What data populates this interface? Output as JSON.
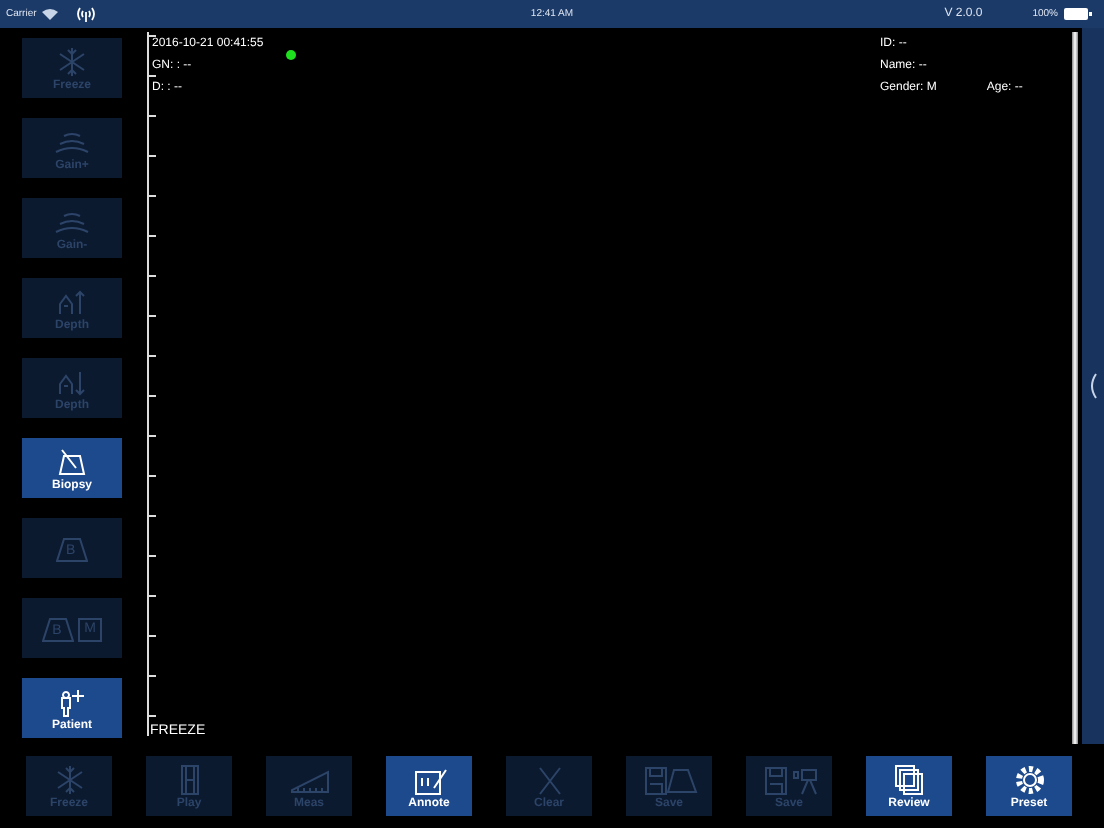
{
  "status_bar": {
    "carrier": "Carrier",
    "time": "12:41 AM",
    "version": "V 2.0.0",
    "battery": "100%"
  },
  "side_buttons": [
    {
      "label": "Freeze",
      "kind": "snowflake",
      "disabled": true
    },
    {
      "label": "Gain+",
      "kind": "gain-up",
      "disabled": true
    },
    {
      "label": "Gain-",
      "kind": "gain-down",
      "disabled": true
    },
    {
      "label": "Depth",
      "kind": "depth-up",
      "disabled": true
    },
    {
      "label": "Depth",
      "kind": "depth-down",
      "disabled": true
    },
    {
      "label": "Biopsy",
      "kind": "biopsy",
      "disabled": false
    },
    {
      "kind": "mode",
      "letters": [
        "B"
      ],
      "disabled": true
    },
    {
      "kind": "mode",
      "letters": [
        "B",
        "M"
      ],
      "disabled": true
    },
    {
      "label": "Patient",
      "kind": "patient",
      "disabled": false
    }
  ],
  "image_area": {
    "datetime": "2016-10-21 00:41:55",
    "gain": "GN: : --",
    "depth": "D: : --",
    "id": "ID: --",
    "name": "Name: --",
    "gender": "Gender: M",
    "age": "Age: --",
    "state": "FREEZE"
  },
  "bottom_buttons": [
    {
      "label": "Freeze",
      "kind": "snowflake",
      "disabled": true
    },
    {
      "label": "Play",
      "kind": "film",
      "disabled": true
    },
    {
      "label": "Meas",
      "kind": "ruler",
      "disabled": true
    },
    {
      "label": "Annote",
      "kind": "annotate",
      "disabled": false
    },
    {
      "label": "Clear",
      "kind": "x",
      "disabled": true
    },
    {
      "label": "Save",
      "kind": "save-image",
      "disabled": true
    },
    {
      "label": "Save",
      "kind": "save-video",
      "disabled": true
    },
    {
      "label": "Review",
      "kind": "review",
      "disabled": false
    },
    {
      "label": "Preset",
      "kind": "gear",
      "disabled": false
    }
  ]
}
